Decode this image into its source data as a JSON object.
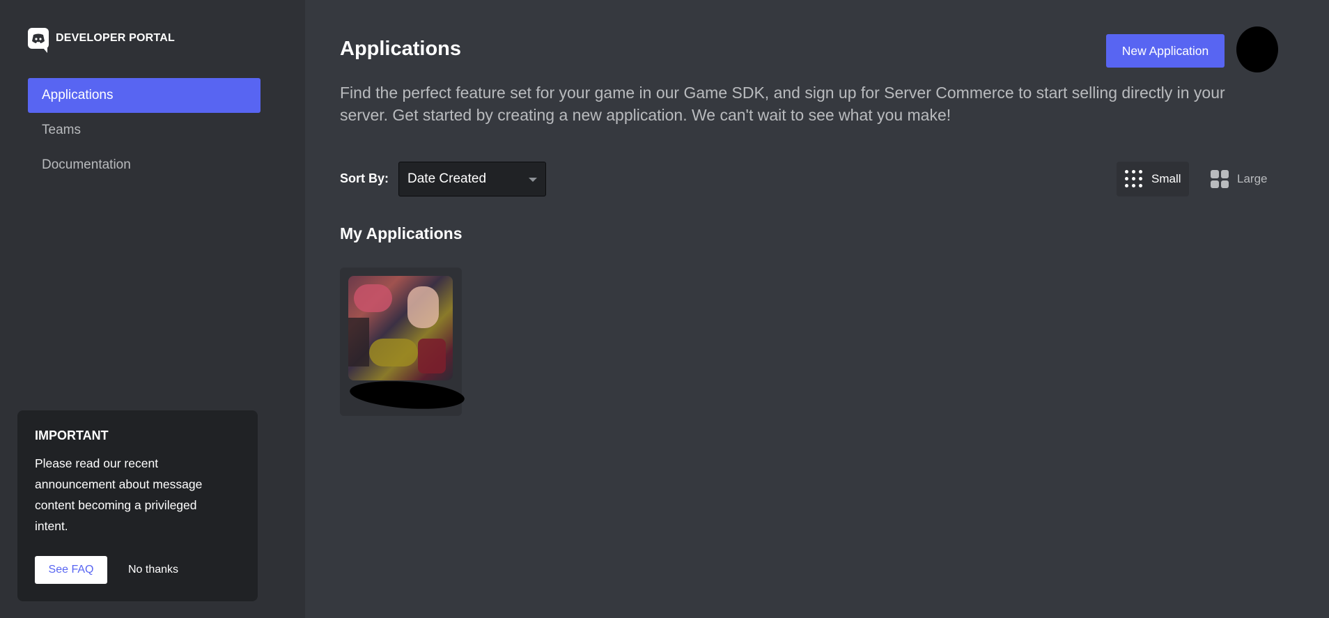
{
  "sidebar": {
    "brand": "DEVELOPER PORTAL",
    "items": [
      {
        "label": "Applications",
        "active": true
      },
      {
        "label": "Teams",
        "active": false
      },
      {
        "label": "Documentation",
        "active": false
      }
    ],
    "notice": {
      "title": "IMPORTANT",
      "body": "Please read our recent announcement about message content becoming a privileged intent.",
      "primary_label": "See FAQ",
      "secondary_label": "No thanks"
    }
  },
  "main": {
    "title": "Applications",
    "new_app_label": "New Application",
    "intro": "Find the perfect feature set for your game in our Game SDK, and sign up for Server Commerce to start selling directly in your server. Get started by creating a new application. We can't wait to see what you make!",
    "sort": {
      "label": "Sort By:",
      "value": "Date Created"
    },
    "views": {
      "small": "Small",
      "large": "Large",
      "selected": "small"
    },
    "section_title": "My Applications"
  },
  "colors": {
    "accent": "#5865f2",
    "background": "#36393f",
    "sidebar": "#2f3136"
  }
}
